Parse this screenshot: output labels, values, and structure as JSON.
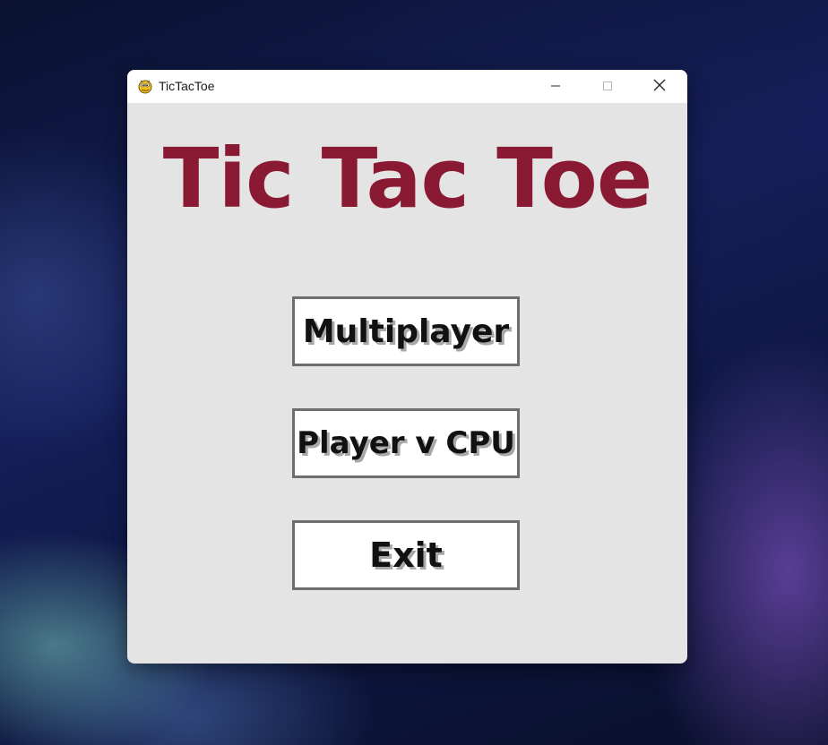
{
  "window": {
    "title": "TicTacToe",
    "app_icon": "pygame-snake-icon",
    "controls": {
      "minimize_icon": "minimize-icon",
      "maximize_icon": "maximize-icon",
      "close_icon": "close-icon"
    }
  },
  "game": {
    "title": "Tic Tac Toe",
    "title_color": "#8a1a33",
    "menu": {
      "multiplayer_label": "Multiplayer",
      "player_vs_cpu_label": "Player v CPU",
      "exit_label": "Exit"
    }
  },
  "colors": {
    "window_background": "#e4e4e4",
    "button_background": "#ffffff",
    "button_border": "#6e6e6e"
  }
}
